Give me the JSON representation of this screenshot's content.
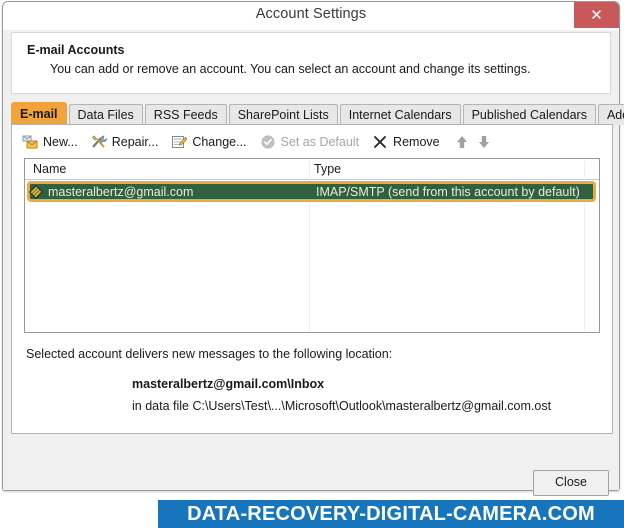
{
  "window": {
    "title": "Account Settings",
    "close_glyph": "✕"
  },
  "header": {
    "title": "E-mail Accounts",
    "description": "You can add or remove an account. You can select an account and change its settings."
  },
  "tabs": [
    {
      "label": "E-mail",
      "active": true
    },
    {
      "label": "Data Files",
      "active": false
    },
    {
      "label": "RSS Feeds",
      "active": false
    },
    {
      "label": "SharePoint Lists",
      "active": false
    },
    {
      "label": "Internet Calendars",
      "active": false
    },
    {
      "label": "Published Calendars",
      "active": false
    },
    {
      "label": "Address Books",
      "active": false
    }
  ],
  "toolbar": {
    "new_label": "New...",
    "repair_label": "Repair...",
    "change_label": "Change...",
    "set_default_label": "Set as Default",
    "remove_label": "Remove",
    "move_up_icon": "arrow-up-icon",
    "move_down_icon": "arrow-down-icon"
  },
  "list": {
    "columns": [
      "Name",
      "Type"
    ],
    "rows": [
      {
        "name": "masteralbertz@gmail.com",
        "type": "IMAP/SMTP (send from this account by default)",
        "selected": true
      }
    ]
  },
  "delivery": {
    "label": "Selected account delivers new messages to the following location:",
    "path": "masteralbertz@gmail.com\\Inbox",
    "datafile": "in data file C:\\Users\\Test\\...\\Microsoft\\Outlook\\masteralbertz@gmail.com.ost"
  },
  "footer": {
    "close_label": "Close"
  },
  "watermark": {
    "text": "DATA-RECOVERY-DIGITAL-CAMERA.COM"
  },
  "colors": {
    "accent_orange": "#f2a93b",
    "selected_row_green": "#2f6042",
    "titlebar_close_red": "#c8585a",
    "watermark_blue": "#1675bc",
    "dialog_face": "#f0f0f0"
  }
}
